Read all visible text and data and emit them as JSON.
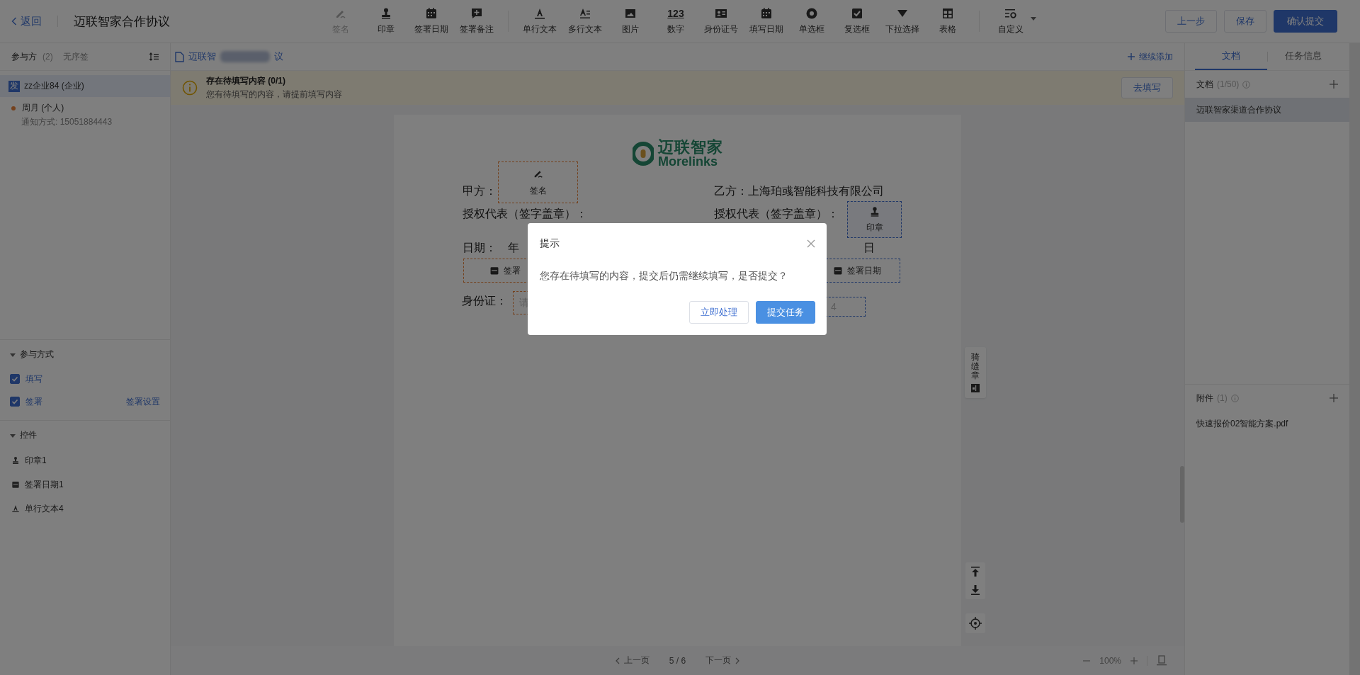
{
  "header": {
    "back": "返回",
    "title": "迈联智家合作协议"
  },
  "toolbar": {
    "groups": [
      [
        {
          "label": "签名",
          "kind": "sign",
          "disabled": true
        },
        {
          "label": "印章",
          "kind": "stamp",
          "disabled": false
        },
        {
          "label": "签署日期",
          "kind": "calendar",
          "disabled": false
        },
        {
          "label": "签署备注",
          "kind": "note",
          "disabled": false
        }
      ],
      [
        {
          "label": "单行文本",
          "kind": "text",
          "disabled": false
        },
        {
          "label": "多行文本",
          "kind": "multitext",
          "disabled": false
        },
        {
          "label": "图片",
          "kind": "image",
          "disabled": false
        },
        {
          "label": "数字",
          "kind": "number",
          "glyph": "123",
          "disabled": false
        },
        {
          "label": "身份证号",
          "kind": "idcard",
          "disabled": false
        },
        {
          "label": "填写日期",
          "kind": "calendar",
          "disabled": false
        },
        {
          "label": "单选框",
          "kind": "radio",
          "disabled": false
        },
        {
          "label": "复选框",
          "kind": "checkbox",
          "disabled": false
        },
        {
          "label": "下拉选择",
          "kind": "dropdown",
          "disabled": false
        },
        {
          "label": "表格",
          "kind": "table",
          "disabled": false
        }
      ],
      [
        {
          "label": "自定义",
          "kind": "custom",
          "caret": true,
          "disabled": false
        }
      ]
    ]
  },
  "actions": [
    {
      "label": "上一步",
      "primary": false
    },
    {
      "label": "保存",
      "primary": false
    },
    {
      "label": "确认提交",
      "primary": true
    }
  ],
  "participants": {
    "title": "参与方",
    "count": "(2)",
    "order": "无序签",
    "items": [
      {
        "kind": "initiator",
        "badge": "发",
        "name": "zz企业84 (企业)",
        "selected": true
      },
      {
        "kind": "signer",
        "name": "周月 (个人)",
        "notice": "通知方式: 15051884443",
        "selected": false
      }
    ]
  },
  "participation": {
    "title": "参与方式",
    "expanded": true,
    "options": [
      {
        "label": "填写",
        "checked": true
      },
      {
        "label": "签署",
        "checked": true,
        "link": "签署设置"
      }
    ]
  },
  "controls": {
    "title": "控件",
    "expanded": true,
    "items": [
      {
        "label": "印章1",
        "kind": "stamp"
      },
      {
        "label": "签署日期1",
        "kind": "calendar"
      },
      {
        "label": "单行文本4",
        "kind": "text"
      }
    ]
  },
  "doc_bar": {
    "file_start": "迈联智",
    "file_end": "议",
    "add": "继续添加"
  },
  "notice": {
    "title": "存在待填写内容 (0/1)",
    "text": "您有待填写的内容，请提前填写内容",
    "button": "去填写"
  },
  "document": {
    "logo_cn": "迈联智家",
    "logo_en": "Morelinks",
    "lines": [
      "甲方：",
      "乙方：上海珀彧智能科技有限公司",
      "授权代表（签字盖章）：",
      "授权代表（签字盖章）：",
      "日期：　年",
      "日",
      "身份证："
    ],
    "fields": [
      {
        "kind": "sign",
        "label": "签名",
        "pending": true
      },
      {
        "kind": "stamp",
        "label": "印章",
        "pending": false
      },
      {
        "kind": "date",
        "label": "签署",
        "pending": true
      },
      {
        "kind": "date",
        "label": "签署日期",
        "pending": false
      },
      {
        "kind": "input",
        "placeholder": "请",
        "pending": true
      },
      {
        "kind": "input",
        "placeholder": "4",
        "pending": false
      }
    ]
  },
  "side_tools": {
    "seam": "骑缝章"
  },
  "pager": {
    "prev": "上一页",
    "page": "5 / 6",
    "next": "下一页",
    "zoom": "100%"
  },
  "right_panel": {
    "tabs": [
      {
        "label": "文档",
        "selected": true
      },
      {
        "label": "任务信息",
        "selected": false
      }
    ],
    "docs": {
      "title": "文档",
      "count": "(1/50)",
      "items": [
        {
          "label": "迈联智家渠道合作协议",
          "selected": true
        }
      ]
    },
    "attachments": {
      "title": "附件",
      "count": "(1)",
      "items": [
        "快速报价02智能方案.pdf"
      ]
    }
  },
  "dialog": {
    "title": "提示",
    "message": "您存在待填写的内容，提交后仍需继续填写，是否提交？",
    "buttons": [
      {
        "label": "立即处理",
        "primary": false
      },
      {
        "label": "提交任务",
        "primary": true
      }
    ]
  }
}
